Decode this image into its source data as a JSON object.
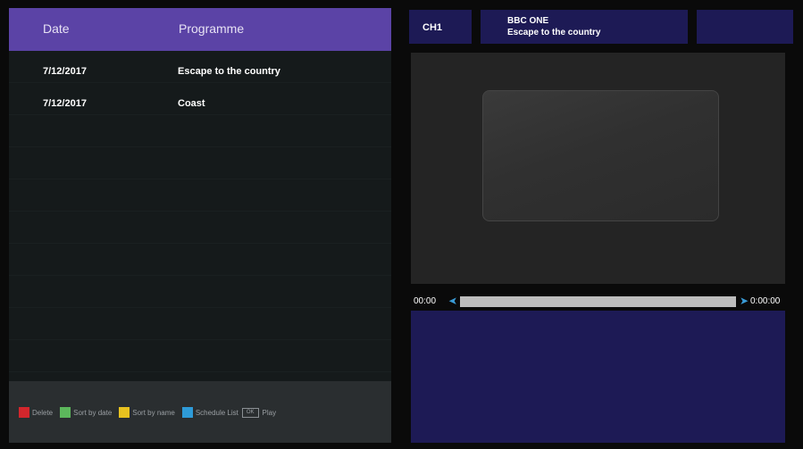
{
  "list": {
    "headers": {
      "date": "Date",
      "programme": "Programme"
    },
    "rows": [
      {
        "date": "7/12/2017",
        "programme": "Escape to the country"
      },
      {
        "date": "7/12/2017",
        "programme": "Coast"
      }
    ]
  },
  "legend": {
    "delete": "Delete",
    "sort_date": "Sort by date",
    "sort_name": "Sort by name",
    "schedule": "Schedule List",
    "ok": "OK",
    "play": "Play",
    "colors": {
      "red": "#d3262c",
      "green": "#5cb85c",
      "yellow": "#e8c21f",
      "blue": "#2e9bd8"
    }
  },
  "channel": {
    "number": "CH1",
    "name": "BBC ONE",
    "programme": "Escape to the country"
  },
  "playback": {
    "start": "00:00",
    "end": "0:00:00"
  },
  "colors": {
    "header": "#5b43a6",
    "info_panel": "#1d1a55",
    "accent_arrow": "#3a9bd6"
  }
}
